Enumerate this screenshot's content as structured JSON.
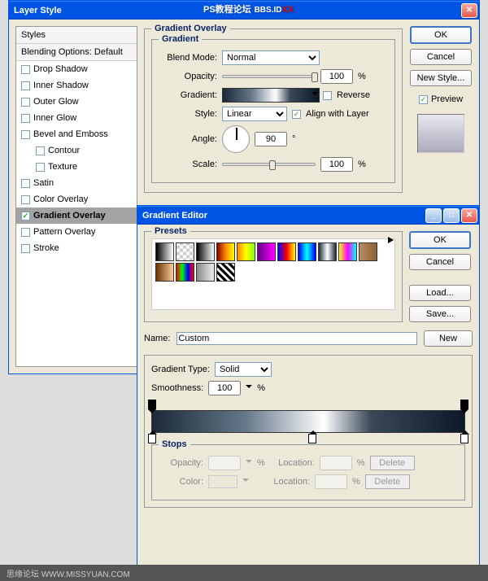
{
  "watermark": {
    "t1": "PS教程论坛",
    "t2": "XX"
  },
  "footer": "思缘论坛  WWW.MISSYUAN.COM",
  "dlg1": {
    "title": "Layer Style",
    "stylesHead": "Styles",
    "blendingOpts": "Blending Options: Default",
    "items": [
      {
        "label": "Drop Shadow",
        "on": false
      },
      {
        "label": "Inner Shadow",
        "on": false
      },
      {
        "label": "Outer Glow",
        "on": false
      },
      {
        "label": "Inner Glow",
        "on": false
      },
      {
        "label": "Bevel and Emboss",
        "on": false
      },
      {
        "label": "Contour",
        "on": false,
        "indent": true
      },
      {
        "label": "Texture",
        "on": false,
        "indent": true
      },
      {
        "label": "Satin",
        "on": false
      },
      {
        "label": "Color Overlay",
        "on": false
      },
      {
        "label": "Gradient Overlay",
        "on": true,
        "sel": true
      },
      {
        "label": "Pattern Overlay",
        "on": false
      },
      {
        "label": "Stroke",
        "on": false
      }
    ],
    "go": {
      "title": "Gradient Overlay",
      "subtitle": "Gradient",
      "blendMode": {
        "lbl": "Blend Mode:",
        "val": "Normal"
      },
      "opacity": {
        "lbl": "Opacity:",
        "val": "100",
        "unit": "%"
      },
      "gradient": {
        "lbl": "Gradient:",
        "reverse": "Reverse"
      },
      "style": {
        "lbl": "Style:",
        "val": "Linear",
        "align": "Align with Layer"
      },
      "angle": {
        "lbl": "Angle:",
        "val": "90",
        "unit": "°"
      },
      "scale": {
        "lbl": "Scale:",
        "val": "100",
        "unit": "%"
      }
    },
    "btns": {
      "ok": "OK",
      "cancel": "Cancel",
      "newStyle": "New Style...",
      "preview": "Preview"
    }
  },
  "dlg2": {
    "title": "Gradient Editor",
    "presets": "Presets",
    "btns": {
      "ok": "OK",
      "cancel": "Cancel",
      "load": "Load...",
      "save": "Save...",
      "new": "New"
    },
    "name": {
      "lbl": "Name:",
      "val": "Custom"
    },
    "gtype": {
      "lbl": "Gradient Type:",
      "val": "Solid"
    },
    "smooth": {
      "lbl": "Smoothness:",
      "val": "100",
      "unit": "%"
    },
    "stops": {
      "title": "Stops",
      "opacity": "Opacity:",
      "color": "Color:",
      "location": "Location:",
      "pct": "%",
      "delete": "Delete"
    },
    "swatches": [
      "linear-gradient(90deg,#000,#fff)",
      "repeating-conic-gradient(#ccc 0 25%,#fff 0 50%) 0/8px 8px",
      "linear-gradient(90deg,#000,#fff)",
      "linear-gradient(90deg,#800,#f80,#ff0)",
      "linear-gradient(90deg,#f80,#ff0,#8f0)",
      "linear-gradient(90deg,#608,#f0f)",
      "linear-gradient(90deg,#00f,#f00,#ff0)",
      "linear-gradient(90deg,#00f,#0ff,#00f)",
      "linear-gradient(90deg,#1a2838,#fff,#1a2838)",
      "linear-gradient(90deg,#ff0,#f0f,#0ff)",
      "linear-gradient(90deg,#b86,#863)",
      "linear-gradient(90deg,#630,#fc9)",
      "linear-gradient(90deg,#f00,#0f0,#00f,#f00)",
      "linear-gradient(90deg,#888,#eee)",
      "repeating-linear-gradient(45deg,#000 0 3px,#fff 3px 6px)"
    ]
  }
}
